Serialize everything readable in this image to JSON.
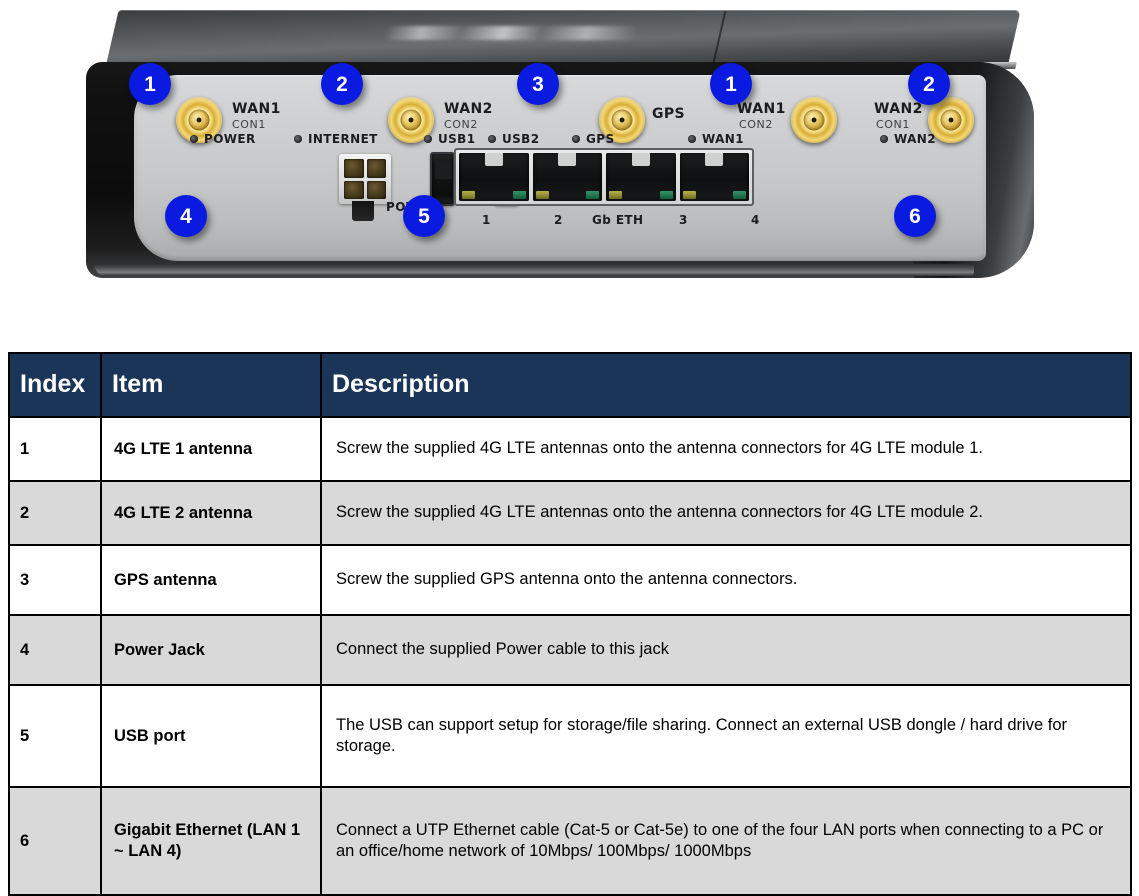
{
  "product_image": {
    "alt_name": "4G LTE router front panel photo",
    "device_labels": [
      {
        "main": "WAN1",
        "sub": "CON1"
      },
      {
        "main": "WAN2",
        "sub": "CON2"
      },
      {
        "main": "GPS",
        "sub": ""
      },
      {
        "main": "WAN1",
        "sub": "CON2"
      },
      {
        "main": "WAN2",
        "sub": "CON1"
      }
    ],
    "led_labels": [
      "POWER",
      "INTERNET",
      "USB1",
      "USB2",
      "GPS",
      "WAN1",
      "WAN2"
    ],
    "power_label": "POWER",
    "eth_port_numbers": [
      "1",
      "2",
      "3",
      "4"
    ],
    "eth_group_label": "Gb ETH",
    "callouts": [
      {
        "num": "1"
      },
      {
        "num": "2"
      },
      {
        "num": "3"
      },
      {
        "num": "1"
      },
      {
        "num": "2"
      },
      {
        "num": "4"
      },
      {
        "num": "5"
      },
      {
        "num": "6"
      }
    ],
    "badge_color": "#0a1ae0"
  },
  "table": {
    "header_color": "#1b3559",
    "alt_row_color": "#d9d9d9",
    "headers": {
      "index": "Index",
      "item": "Item",
      "description": "Description"
    },
    "rows": [
      {
        "index": "1",
        "item": "4G LTE 1 antenna",
        "description": "Screw the supplied 4G LTE antennas onto the antenna connectors for 4G LTE module 1."
      },
      {
        "index": "2",
        "item": "4G LTE 2 antenna",
        "description": "Screw the supplied 4G LTE antennas onto the antenna connectors for 4G LTE module 2."
      },
      {
        "index": "3",
        "item": "GPS antenna",
        "description": "Screw the supplied GPS antenna onto the antenna connectors."
      },
      {
        "index": "4",
        "item": "Power Jack",
        "description": "Connect the supplied Power cable to this jack"
      },
      {
        "index": "5",
        "item": "USB port",
        "description": "The USB can support setup for storage/file sharing. Connect an external USB dongle / hard drive for storage."
      },
      {
        "index": "6",
        "item": "Gigabit Ethernet (LAN 1 ~ LAN 4)",
        "description": "Connect a UTP Ethernet cable (Cat-5 or Cat-5e) to one of the four LAN ports when connecting to a PC or an office/home network of 10Mbps/ 100Mbps/ 1000Mbps"
      }
    ]
  }
}
